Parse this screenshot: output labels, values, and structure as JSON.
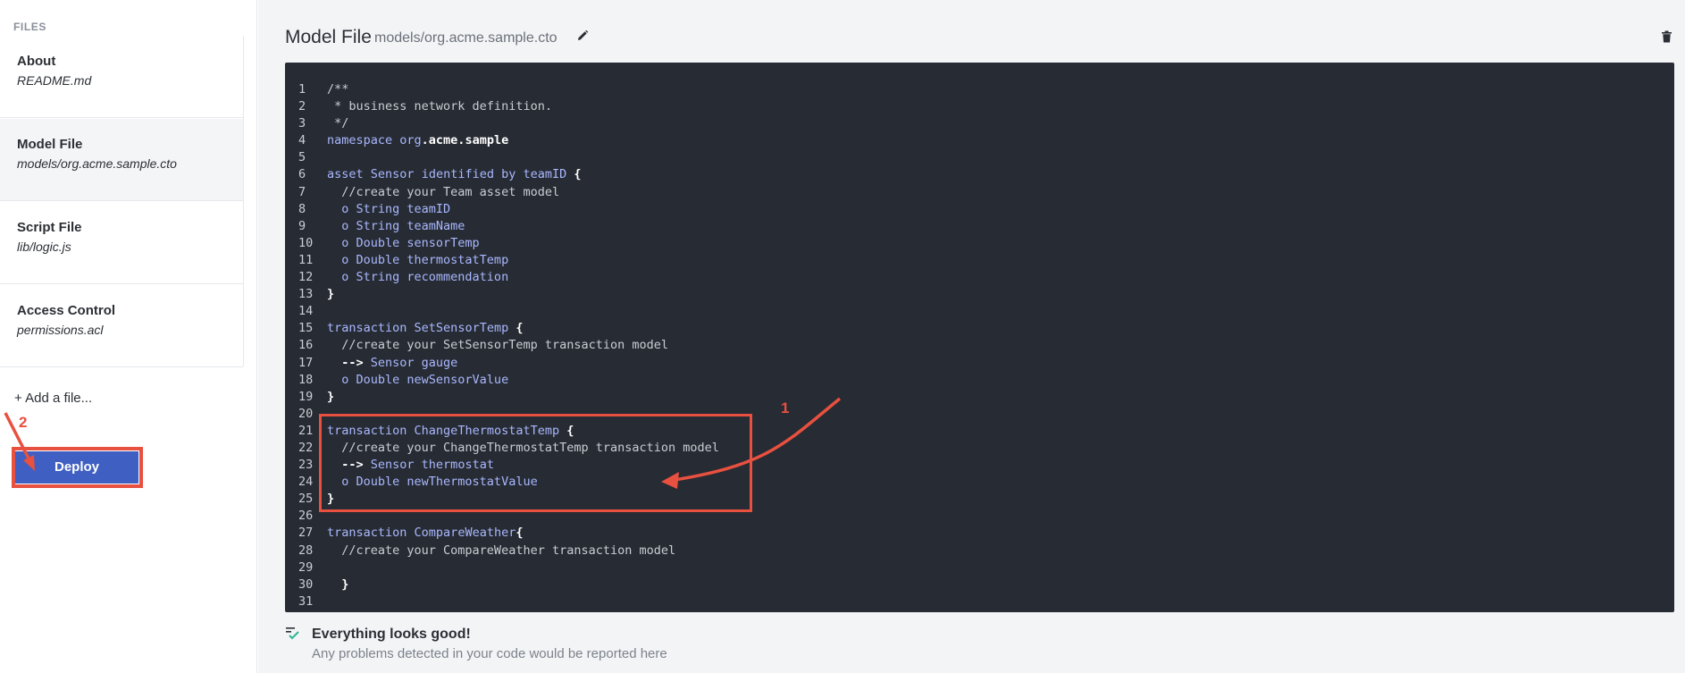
{
  "sidebar": {
    "header": "FILES",
    "items": [
      {
        "title": "About",
        "path": "README.md",
        "active": false
      },
      {
        "title": "Model File",
        "path": "models/org.acme.sample.cto",
        "active": true
      },
      {
        "title": "Script File",
        "path": "lib/logic.js",
        "active": false
      },
      {
        "title": "Access Control",
        "path": "permissions.acl",
        "active": false
      }
    ],
    "add_file_label": "+ Add a file...",
    "deploy_label": "Deploy"
  },
  "editor_header": {
    "title": "Model File",
    "path": "models/org.acme.sample.cto",
    "edit_icon": "pencil-icon",
    "delete_icon": "trash-icon"
  },
  "code": {
    "lines": [
      {
        "n": "1",
        "tokens": [
          {
            "t": "/**",
            "c": "comment"
          }
        ]
      },
      {
        "n": "2",
        "tokens": [
          {
            "t": " * business network definition.",
            "c": "comment"
          }
        ]
      },
      {
        "n": "3",
        "tokens": [
          {
            "t": " */",
            "c": "comment"
          }
        ]
      },
      {
        "n": "4",
        "tokens": [
          {
            "t": "namespace ",
            "c": "kw"
          },
          {
            "t": "org",
            "c": "kw"
          },
          {
            "t": ".acme.sample",
            "c": "plain"
          }
        ]
      },
      {
        "n": "5",
        "tokens": []
      },
      {
        "n": "6",
        "tokens": [
          {
            "t": "asset ",
            "c": "kw"
          },
          {
            "t": "Sensor ",
            "c": "def"
          },
          {
            "t": "identified by ",
            "c": "kw"
          },
          {
            "t": "teamID ",
            "c": "def"
          },
          {
            "t": "{",
            "c": "plain"
          }
        ]
      },
      {
        "n": "7",
        "tokens": [
          {
            "t": "  //create your Team asset model",
            "c": "comment"
          }
        ]
      },
      {
        "n": "8",
        "tokens": [
          {
            "t": "  o String teamID",
            "c": "kw"
          }
        ]
      },
      {
        "n": "9",
        "tokens": [
          {
            "t": "  o String teamName",
            "c": "kw"
          }
        ]
      },
      {
        "n": "10",
        "tokens": [
          {
            "t": "  o Double sensorTemp",
            "c": "kw"
          }
        ]
      },
      {
        "n": "11",
        "tokens": [
          {
            "t": "  o Double thermostatTemp",
            "c": "kw"
          }
        ]
      },
      {
        "n": "12",
        "tokens": [
          {
            "t": "  o String recommendation",
            "c": "kw"
          }
        ]
      },
      {
        "n": "13",
        "tokens": [
          {
            "t": "}",
            "c": "plain"
          }
        ]
      },
      {
        "n": "14",
        "tokens": []
      },
      {
        "n": "15",
        "tokens": [
          {
            "t": "transaction ",
            "c": "kw"
          },
          {
            "t": "SetSensorTemp ",
            "c": "def"
          },
          {
            "t": "{",
            "c": "plain"
          }
        ]
      },
      {
        "n": "16",
        "tokens": [
          {
            "t": "  //create your SetSensorTemp transaction model",
            "c": "comment"
          }
        ]
      },
      {
        "n": "17",
        "tokens": [
          {
            "t": "  --> ",
            "c": "plain"
          },
          {
            "t": "Sensor gauge",
            "c": "kw"
          }
        ]
      },
      {
        "n": "18",
        "tokens": [
          {
            "t": "  o Double newSensorValue",
            "c": "kw"
          }
        ]
      },
      {
        "n": "19",
        "tokens": [
          {
            "t": "}",
            "c": "plain"
          }
        ]
      },
      {
        "n": "20",
        "tokens": []
      },
      {
        "n": "21",
        "tokens": [
          {
            "t": "transaction ",
            "c": "kw"
          },
          {
            "t": "ChangeThermostatTemp ",
            "c": "def"
          },
          {
            "t": "{",
            "c": "plain"
          }
        ]
      },
      {
        "n": "22",
        "tokens": [
          {
            "t": "  //create your ChangeThermostatTemp transaction model",
            "c": "comment"
          }
        ]
      },
      {
        "n": "23",
        "tokens": [
          {
            "t": "  --> ",
            "c": "plain"
          },
          {
            "t": "Sensor thermostat",
            "c": "kw"
          }
        ]
      },
      {
        "n": "24",
        "tokens": [
          {
            "t": "  o Double newThermostatValue",
            "c": "kw"
          }
        ]
      },
      {
        "n": "25",
        "tokens": [
          {
            "t": "}",
            "c": "plain"
          }
        ]
      },
      {
        "n": "26",
        "tokens": []
      },
      {
        "n": "27",
        "tokens": [
          {
            "t": "transaction ",
            "c": "kw"
          },
          {
            "t": "CompareWeather",
            "c": "def"
          },
          {
            "t": "{",
            "c": "plain"
          }
        ]
      },
      {
        "n": "28",
        "tokens": [
          {
            "t": "  //create your CompareWeather transaction model",
            "c": "comment"
          }
        ]
      },
      {
        "n": "29",
        "tokens": []
      },
      {
        "n": "30",
        "tokens": [
          {
            "t": "  }",
            "c": "plain"
          }
        ]
      },
      {
        "n": "31",
        "tokens": []
      }
    ]
  },
  "status": {
    "icon": "check-list-icon",
    "title": "Everything looks good!",
    "description": "Any problems detected in your code would be reported here"
  },
  "annotations": {
    "label_1": "1",
    "label_2": "2",
    "color": "#e8503f"
  }
}
